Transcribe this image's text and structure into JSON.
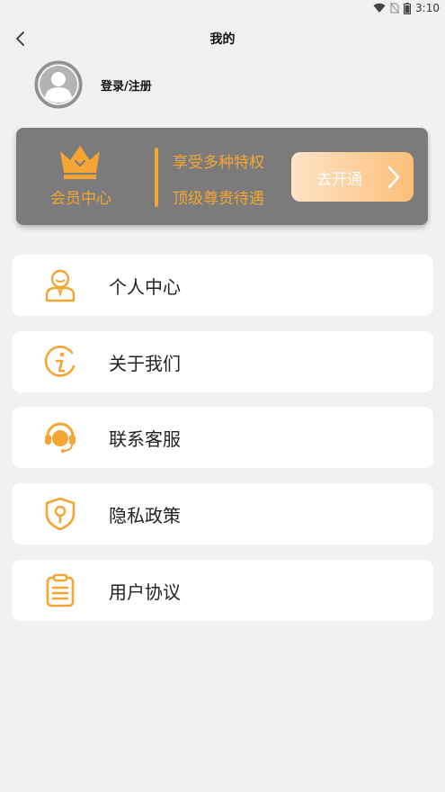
{
  "status_bar": {
    "time": "3:10"
  },
  "nav": {
    "title": "我的"
  },
  "profile": {
    "login_label": "登录/注册"
  },
  "vip": {
    "title": "会员中心",
    "line1": "享受多种特权",
    "line2": "顶级尊贵待遇",
    "button_label": "去开通",
    "accent_color": "#f4a533"
  },
  "menu": [
    {
      "label": "个人中心",
      "icon": "user-icon"
    },
    {
      "label": "关于我们",
      "icon": "info-icon"
    },
    {
      "label": "联系客服",
      "icon": "headset-icon"
    },
    {
      "label": "隐私政策",
      "icon": "shield-icon"
    },
    {
      "label": "用户协议",
      "icon": "clipboard-icon"
    }
  ]
}
